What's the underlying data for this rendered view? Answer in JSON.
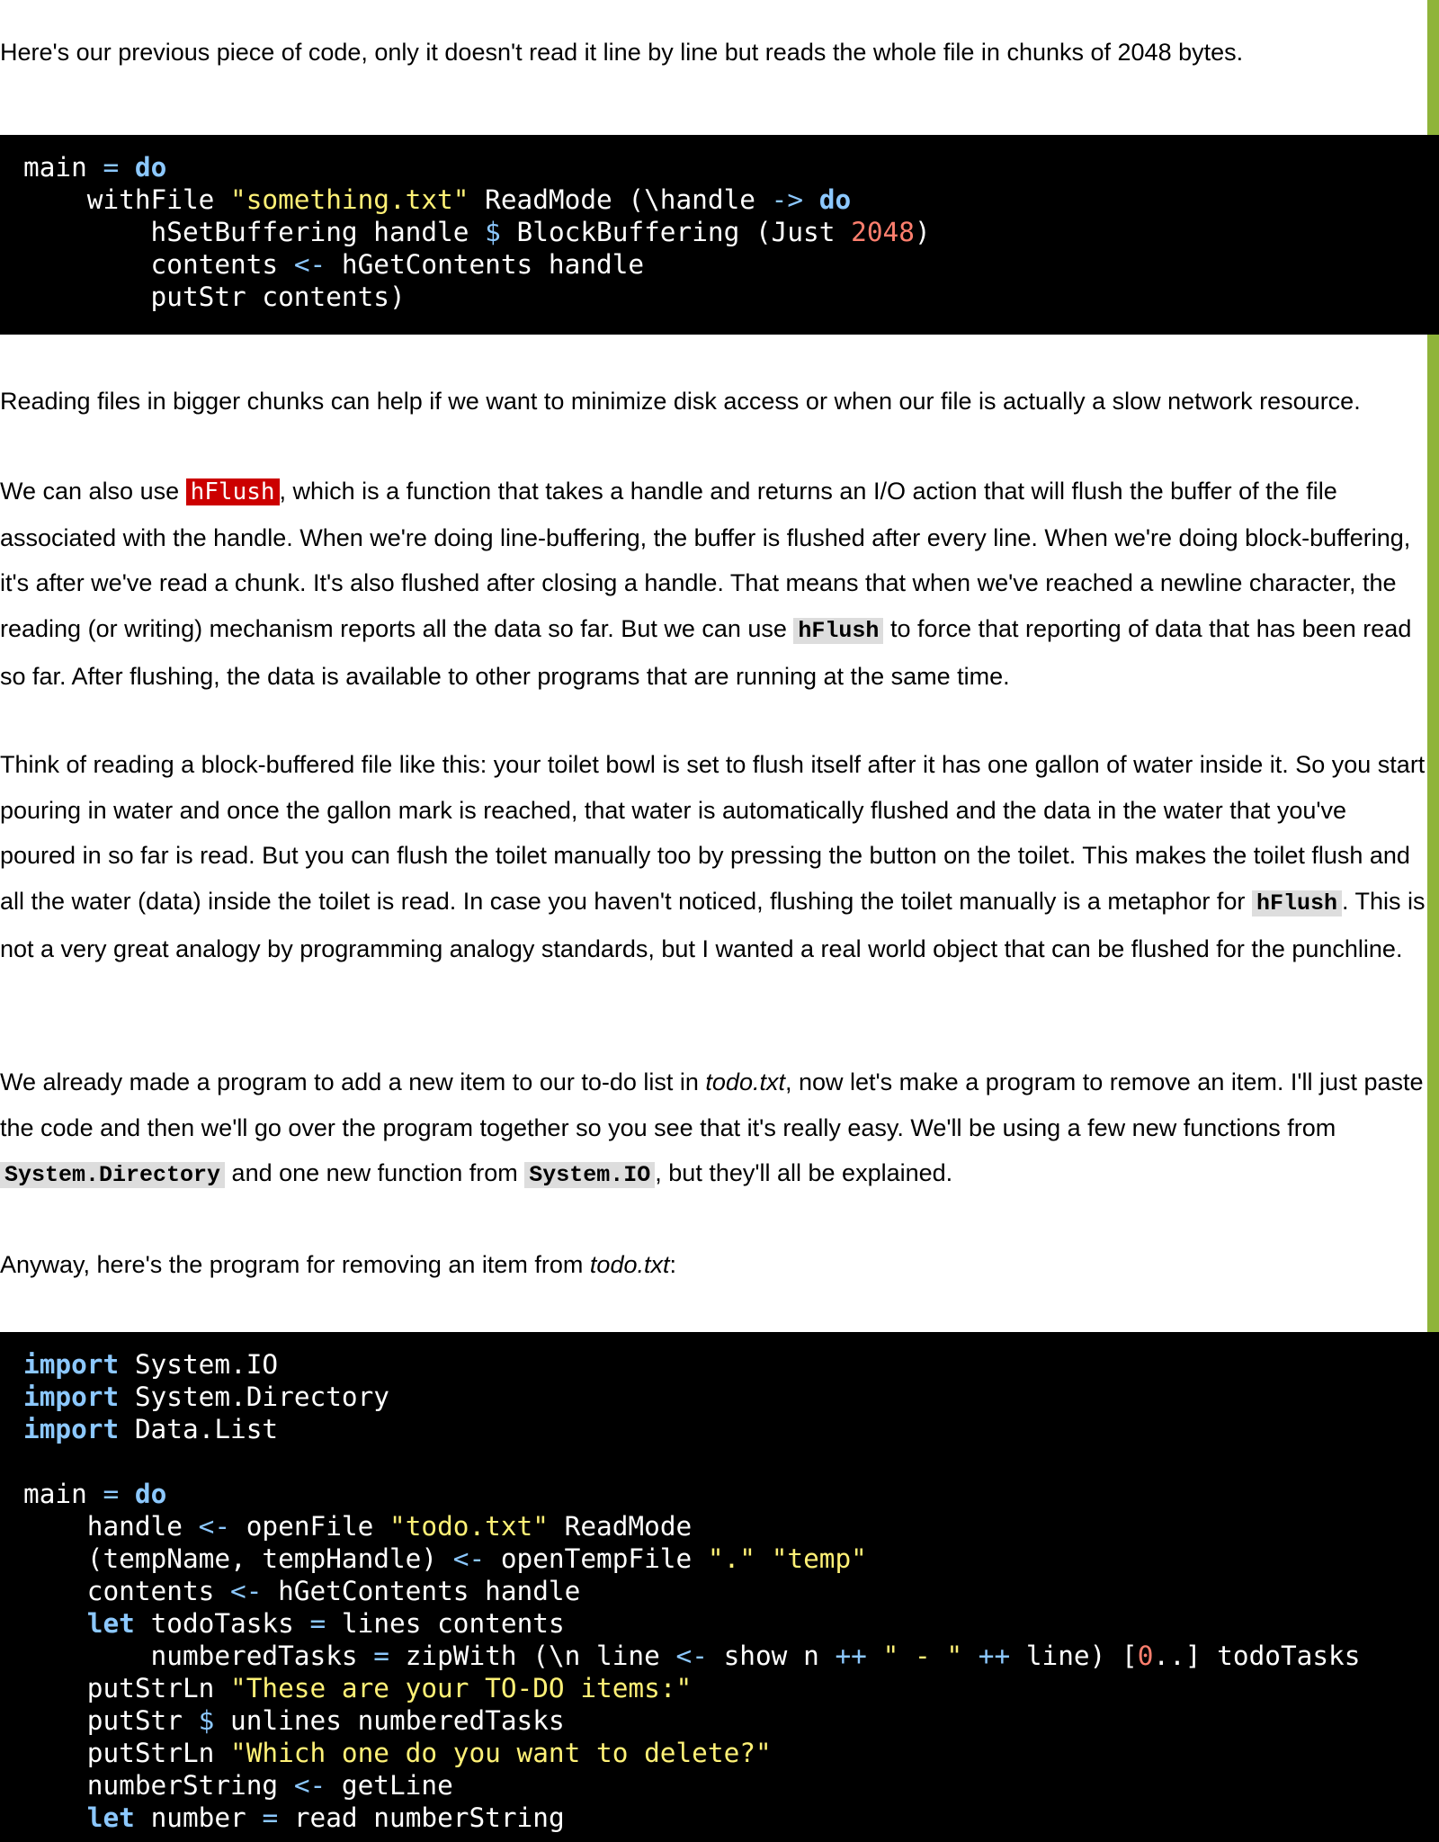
{
  "colors": {
    "accent_bar": "#8fb43a",
    "code_background": "#000000",
    "keyword": "#8cc8ff",
    "string": "#fff176",
    "number": "#ff7f6e",
    "inline_highlight": "#cc0000"
  },
  "p1": "Here's our previous piece of code, only it doesn't read it line by line but reads the whole file in chunks of 2048 bytes.",
  "code1": {
    "l1_a": "main ",
    "l1_eq": "=",
    "l1_do": "do",
    "l2_a": "    withFile ",
    "l2_str": "\"something.txt\"",
    "l2_b": " ReadMode (\\handle ",
    "l2_arrow": "->",
    "l2_do": "do",
    "l3_a": "        hSetBuffering handle ",
    "l3_dollar": "$",
    "l3_b": " BlockBuffering (Just ",
    "l3_num": "2048",
    "l3_c": ")",
    "l4_a": "        contents ",
    "l4_arrow": "<-",
    "l4_b": " hGetContents handle",
    "l5_a": "        putStr contents)"
  },
  "p2": "Reading files in bigger chunks can help if we want to minimize disk access or when our file is actually a slow network resource.",
  "p3": {
    "t1": "We can also use ",
    "c1": "hFlush",
    "t2": ", which is a function that takes a handle and returns an I/O action that will flush the buffer of the file associated with the handle. When we're doing line-buffering, the buffer is flushed after every line. When we're doing block-buffering, it's after we've read a chunk. It's also flushed after closing a handle. That means that when we've reached a newline character, the reading (or writing) mechanism reports all the data so far. But we can use ",
    "c2": "hFlush",
    "t3": " to force that reporting of data that has been read so far. After flushing, the data is available to other programs that are running at the same time."
  },
  "p4": {
    "t1": "Think of reading a block-buffered file like this: your toilet bowl is set to flush itself after it has one gallon of water inside it. So you start pouring in water and once the gallon mark is reached, that water is automatically flushed and the data in the water that you've poured in so far is read. But you can flush the toilet manually too by pressing the button on the toilet. This makes the toilet flush and all the water (data) inside the toilet is read. In case you haven't noticed, flushing the toilet manually is a metaphor for ",
    "c1": "hFlush",
    "t2": ". This is not a very great analogy by programming analogy standards, but I wanted a real world object that can be flushed for the punchline."
  },
  "p5": {
    "t1": "We already made a program to add a new item to our to-do list in ",
    "em1": "todo.txt",
    "t2": ", now let's make a program to remove an item. I'll just paste the code and then we'll go over the program together so you see that it's really easy. We'll be using a few new functions from ",
    "c1": "System.Directory",
    "t3": " and one new function from ",
    "c2": "System.IO",
    "t4": ", but they'll all be explained."
  },
  "p6": {
    "t1": "Anyway, here's the program for removing an item from ",
    "em1": "todo.txt",
    "t2": ":"
  },
  "code2": {
    "kw_import": "import",
    "m1": " System.IO",
    "m2": " System.Directory",
    "m3": " Data.List",
    "main_a": "main ",
    "eq": "=",
    "kw_do": "do",
    "h_a": "    handle ",
    "arrow": "<-",
    "h_b": " openFile ",
    "h_str": "\"todo.txt\"",
    "h_c": " ReadMode",
    "t_a": "    (tempName, tempHandle) ",
    "t_b": " openTempFile ",
    "t_str1": "\".\"",
    "t_sp": " ",
    "t_str2": "\"temp\"",
    "c_a": "    contents ",
    "c_b": " hGetContents handle",
    "l_ind": "    ",
    "kw_let": "let",
    "l_a": " todoTasks ",
    "l_b": " lines contents",
    "n_a": "        numberedTasks ",
    "n_b": " zipWith (\\n line ",
    "n_c": " show n ",
    "plusplus": "++",
    "n_str": "\" - \"",
    "n_d": " line) [",
    "n_num": "0",
    "n_e": "..] todoTasks",
    "p1_a": "    putStrLn ",
    "p1_str": "\"These are your TO-DO items:\"",
    "p2_a": "    putStr ",
    "dollar": "$",
    "p2_b": " unlines numberedTasks",
    "p3_a": "    putStrLn ",
    "p3_str": "\"Which one do you want to delete?\"",
    "g_a": "    numberString ",
    "g_b": " getLine",
    "r_a": " number ",
    "r_b": " read numberString"
  }
}
